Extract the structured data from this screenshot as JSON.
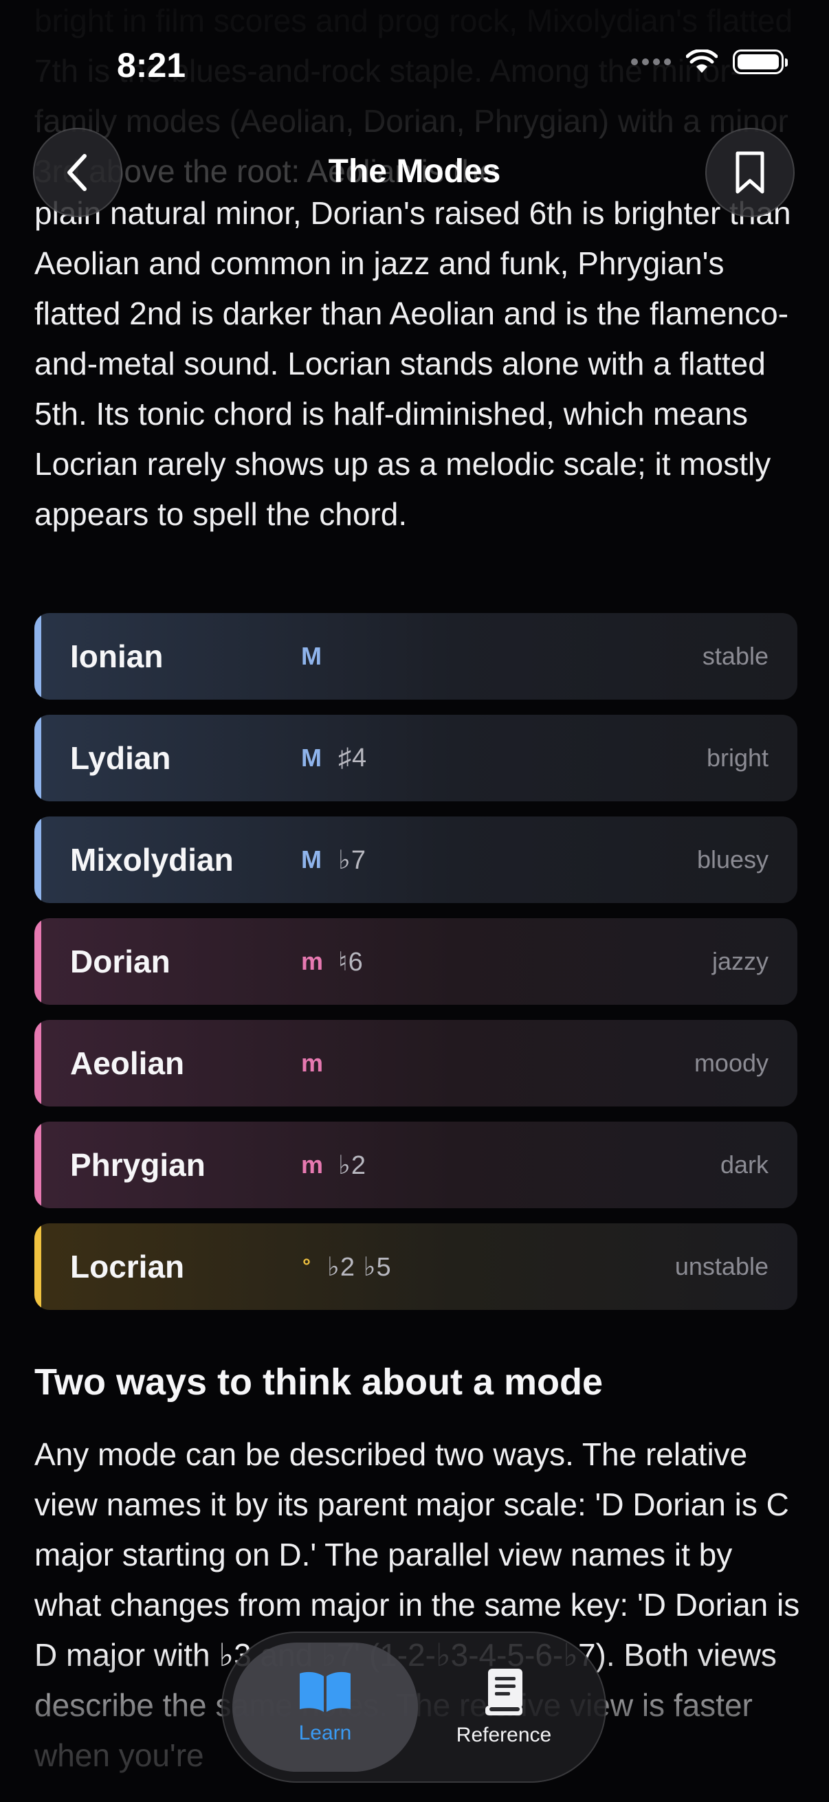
{
  "status_bar": {
    "time": "8:21"
  },
  "nav": {
    "title": "The Modes"
  },
  "faded_top_text": "bright in film scores and prog rock, Mixolydian's flatted 7th is the blues-and-rock staple. Among the minor-family modes (Aeolian, Dorian, Phrygian) with a minor 3rd above the root: Aeolian is the",
  "intro_paragraph": "plain natural minor, Dorian's raised 6th is brighter than Aeolian and common in jazz and funk, Phrygian's flatted 2nd is darker than Aeolian and is the flamenco-and-metal sound. Locrian stands alone with a flatted 5th. Its tonic chord is half-diminished, which means Locrian rarely shows up as a melodic scale; it mostly appears to spell the chord.",
  "modes": [
    {
      "name": "Ionian",
      "quality": "M",
      "alterations": "",
      "mood": "stable",
      "family": "major"
    },
    {
      "name": "Lydian",
      "quality": "M",
      "alterations": "♯4",
      "mood": "bright",
      "family": "major"
    },
    {
      "name": "Mixolydian",
      "quality": "M",
      "alterations": "♭7",
      "mood": "bluesy",
      "family": "major"
    },
    {
      "name": "Dorian",
      "quality": "m",
      "alterations": "♮6",
      "mood": "jazzy",
      "family": "minor"
    },
    {
      "name": "Aeolian",
      "quality": "m",
      "alterations": "",
      "mood": "moody",
      "family": "minor"
    },
    {
      "name": "Phrygian",
      "quality": "m",
      "alterations": "♭2",
      "mood": "dark",
      "family": "minor"
    },
    {
      "name": "Locrian",
      "quality": "°",
      "alterations": "♭2 ♭5",
      "mood": "unstable",
      "family": "diminished"
    }
  ],
  "section": {
    "heading": "Two ways to think about a mode",
    "paragraph": "Any mode can be described two ways. The relative view names it by its parent major scale: 'D Dorian is C major starting on D.' The parallel view names it by what changes from major in the same key: 'D Dorian is D major with ♭3 and ♭7' (1-2-♭3-4-5-6-♭7). Both views describe the same notes. The relative view is faster when you're"
  },
  "tabs": [
    {
      "label": "Learn",
      "icon": "open-book-icon",
      "active": true
    },
    {
      "label": "Reference",
      "icon": "reference-book-icon",
      "active": false
    }
  ],
  "colors": {
    "major": "#8fb4ec",
    "minor": "#e779b1",
    "diminished": "#f0c240",
    "active_tab": "#3a9bf4"
  }
}
